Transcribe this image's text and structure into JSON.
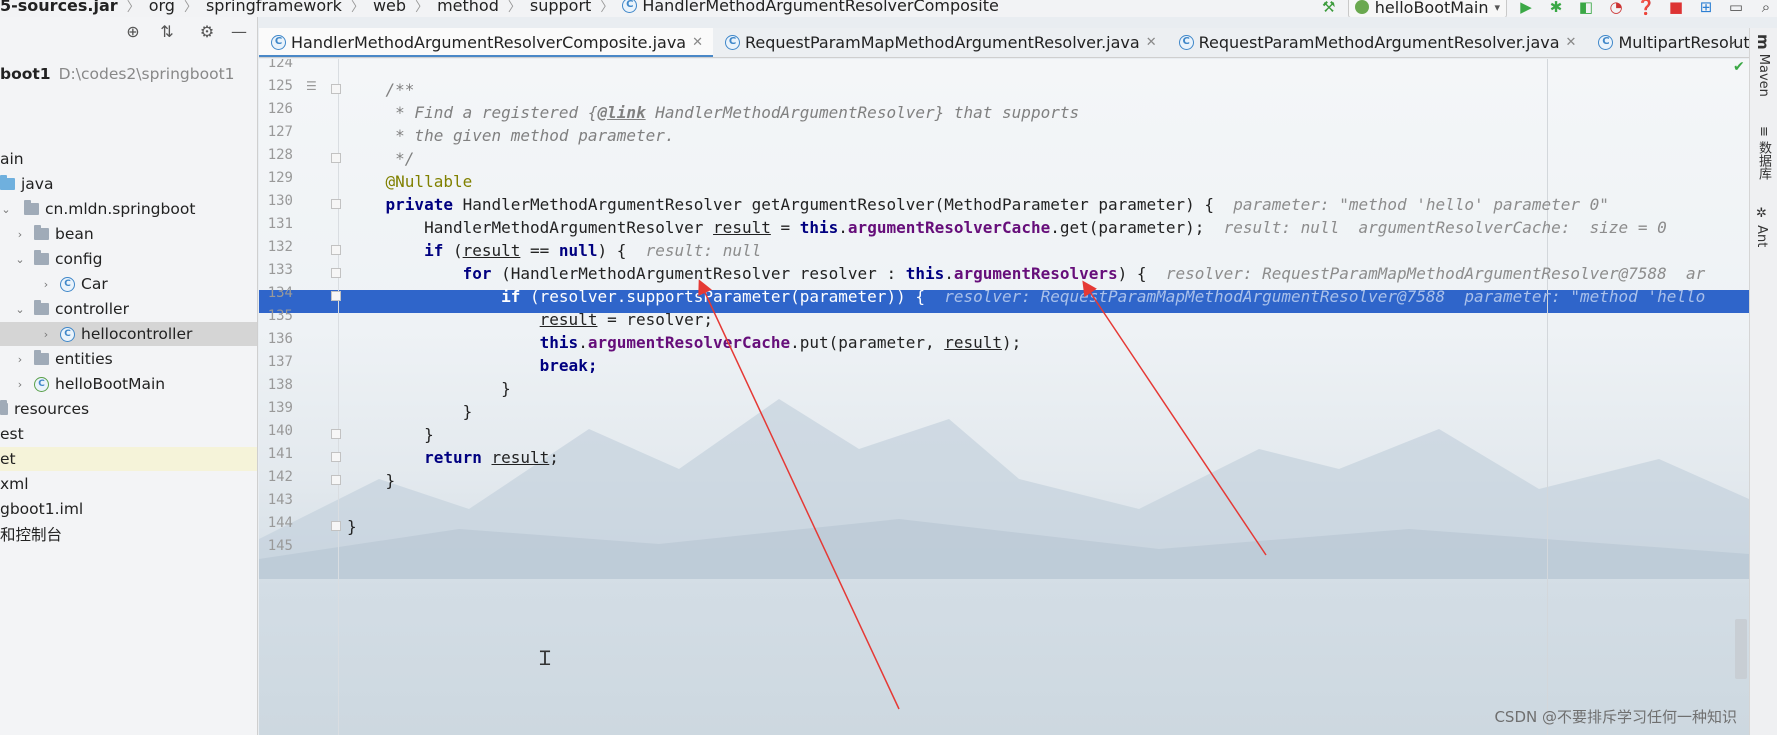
{
  "breadcrumbs": [
    {
      "label": "5-sources.jar"
    },
    {
      "label": "org"
    },
    {
      "label": "springframework"
    },
    {
      "label": "web"
    },
    {
      "label": "method"
    },
    {
      "label": "support"
    },
    {
      "label": "HandlerMethodArgumentResolverComposite"
    }
  ],
  "run_config": {
    "label": "helloBootMain"
  },
  "project": {
    "root_name": "boot1",
    "root_path": "D:\\codes2\\springboot1",
    "items": [
      {
        "label": "ain"
      },
      {
        "label": "java"
      },
      {
        "label": "cn.mldn.springboot"
      },
      {
        "label": "bean"
      },
      {
        "label": "config"
      },
      {
        "label": "Car"
      },
      {
        "label": "controller"
      },
      {
        "label": "hellocontroller"
      },
      {
        "label": "entities"
      },
      {
        "label": "helloBootMain"
      },
      {
        "label": "resources"
      },
      {
        "label": "est"
      },
      {
        "label": "et"
      },
      {
        "label": "xml"
      },
      {
        "label": "gboot1.iml"
      },
      {
        "label": "和控制台"
      }
    ]
  },
  "tabs": [
    {
      "label": "HandlerMethodArgumentResolverComposite.java"
    },
    {
      "label": "RequestParamMapMethodArgumentResolver.java"
    },
    {
      "label": "RequestParamMethodArgumentResolver.java"
    },
    {
      "label": "MultipartResolutionDele"
    }
  ],
  "side_tools": [
    {
      "label": "Maven"
    },
    {
      "label": "数据库"
    },
    {
      "label": "Ant"
    }
  ],
  "editor": {
    "line_numbers": [
      "124",
      "125",
      "126",
      "127",
      "128",
      "129",
      "130",
      "131",
      "132",
      "133",
      "134",
      "135",
      "136",
      "137",
      "138",
      "139",
      "140",
      "141",
      "142",
      "143",
      "144",
      "145"
    ],
    "current_line": "134",
    "code": {
      "l125": "/**",
      "l126_a": " * Find a registered {",
      "l126_tag": "@link",
      "l126_b": " HandlerMethodArgumentResolver} that supports",
      "l127": " * the given method parameter.",
      "l128": " */",
      "l129": "@Nullable",
      "l130_kw": "private",
      "l130_rest": " HandlerMethodArgumentResolver getArgumentResolver(MethodParameter parameter) {",
      "l130_hint": "parameter: \"method 'hello' parameter 0\"",
      "l131_a": "HandlerMethodArgumentResolver ",
      "l131_var": "result",
      "l131_b": " = ",
      "l131_this": "this",
      "l131_dot": ".",
      "l131_fld": "argumentResolverCache",
      "l131_c": ".get(parameter);",
      "l131_hint": "result: null  argumentResolverCache:  size = 0",
      "l132_kw": "if",
      "l132_a": " (",
      "l132_var": "result",
      "l132_b": " == ",
      "l132_null": "null",
      "l132_c": ") {",
      "l132_hint": "result: null",
      "l133_kw": "for",
      "l133_a": " (HandlerMethodArgumentResolver resolver : ",
      "l133_this": "this",
      "l133_dot": ".",
      "l133_fld": "argumentResolvers",
      "l133_b": ") {",
      "l133_hint": "resolver: RequestParamMapMethodArgumentResolver@7588  ar",
      "l134_kw": "if",
      "l134_a": " (resolver.supportsParameter(parameter)) {",
      "l134_hint": "resolver: RequestParamMapMethodArgumentResolver@7588  parameter: \"method 'hello",
      "l135_var": "result",
      "l135_a": " = resolver;",
      "l136_this": "this",
      "l136_dot": ".",
      "l136_fld": "argumentResolverCache",
      "l136_a": ".put(parameter, ",
      "l136_var": "result",
      "l136_b": ");",
      "l137": "break;",
      "l138": "}",
      "l139": "}",
      "l140": "}",
      "l141_kw": "return",
      "l141_sp": " ",
      "l141_var": "result",
      "l141_semi": ";",
      "l142": "}",
      "l144": "}"
    }
  },
  "watermark": "CSDN @不要排斥学习任何一种知识",
  "colors": {
    "accent": "#4a88c7",
    "current_line": "#2f65ca",
    "keyword": "#000080",
    "field": "#660e7a",
    "annotation": "#808000",
    "arrow": "#e53935"
  },
  "icons": [
    "build-hammer-icon",
    "run-icon",
    "debug-icon",
    "coverage-icon",
    "profile-icon",
    "help-icon",
    "stop-icon",
    "search-icon",
    "structure-icon",
    "layout-icon",
    "target-icon",
    "collapse-icon",
    "gear-icon",
    "minimize-icon",
    "chevron-down-icon"
  ]
}
